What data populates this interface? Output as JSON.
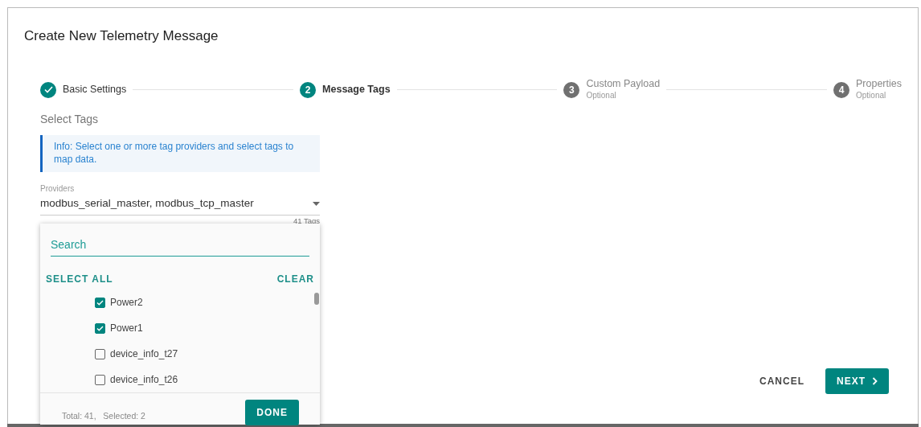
{
  "dialog": {
    "title": "Create New Telemetry Message"
  },
  "steps": [
    {
      "label": "Basic Settings",
      "completed": true,
      "selected": false
    },
    {
      "number": "2",
      "label": "Message Tags",
      "completed": false,
      "selected": true
    },
    {
      "number": "3",
      "label": "Custom Payload",
      "sublabel": "Optional",
      "completed": false,
      "selected": false
    },
    {
      "number": "4",
      "label": "Properties",
      "sublabel": "Optional",
      "completed": false,
      "selected": false
    }
  ],
  "section_title": "Select Tags",
  "info": "Info: Select one or more tag providers and select tags to map data.",
  "providers": {
    "label": "Providers",
    "value": "modbus_serial_master, modbus_tcp_master",
    "hint": "41 Tags"
  },
  "dropdown": {
    "search": {
      "placeholder": "Search"
    },
    "select_all": "SELECT ALL",
    "clear": "CLEAR",
    "tags": [
      {
        "label": "Power2",
        "checked": true
      },
      {
        "label": "Power1",
        "checked": true
      },
      {
        "label": "device_info_t27",
        "checked": false
      },
      {
        "label": "device_info_t26",
        "checked": false
      }
    ],
    "summary": "Total: 41,   Selected: 2",
    "done": "DONE"
  },
  "buttons": {
    "cancel": "CANCEL",
    "next": "NEXT"
  }
}
